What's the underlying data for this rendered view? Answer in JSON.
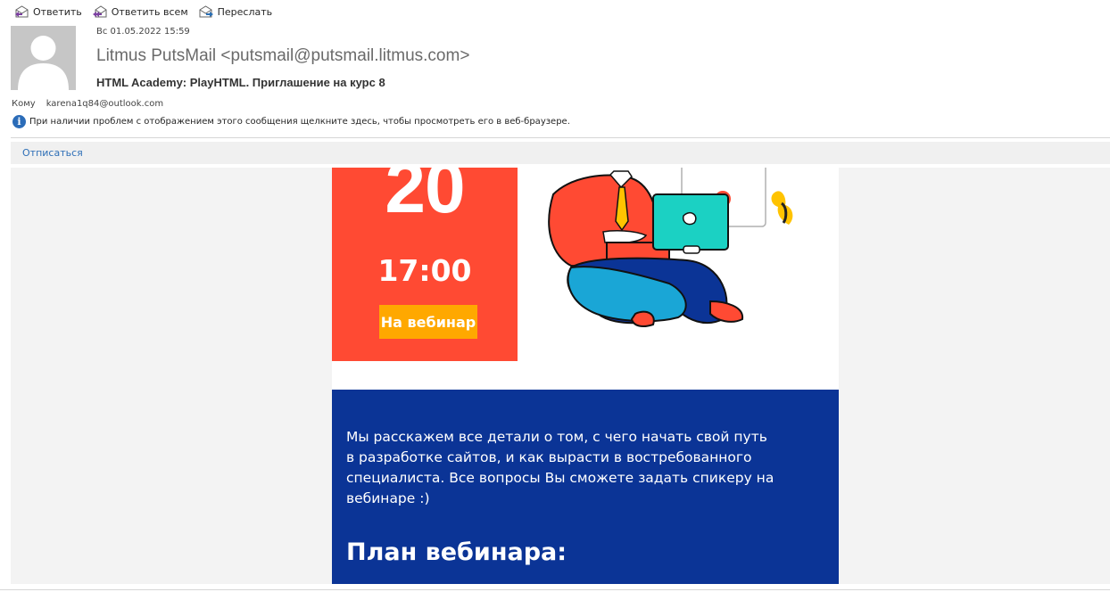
{
  "toolbar": {
    "reply": "Ответить",
    "reply_all": "Ответить всем",
    "forward": "Переслать"
  },
  "header": {
    "date": "Вс 01.05.2022 15:59",
    "sender": "Litmus PutsMail <putsmail@putsmail.litmus.com>",
    "subject": "HTML Academy: PlayHTML. Приглашение на курс 8",
    "to_label": "Кому",
    "to_value": "karena1q84@outlook.com",
    "info_message": "При наличии проблем с отображением этого сообщения щелкните здесь, чтобы просмотреть его в веб-браузере."
  },
  "unsubscribe": "Отписаться",
  "email": {
    "day": "20",
    "time": "17:00",
    "cta": "На вебинар",
    "description": "Мы расскажем все детали о том, с чего начать свой путь в разработке сайтов, и как вырасти в востребованного специалиста. Все вопросы Вы сможете задать спикеру на вебинаре :)",
    "plan_title": "План вебинара:"
  },
  "colors": {
    "red_card": "#ff4a33",
    "cta_bg": "#ffa800",
    "blue_block": "#0b3496",
    "link": "#2e6fb7"
  },
  "icons": [
    "reply-icon",
    "reply-all-icon",
    "forward-icon",
    "info-icon",
    "avatar-placeholder"
  ]
}
